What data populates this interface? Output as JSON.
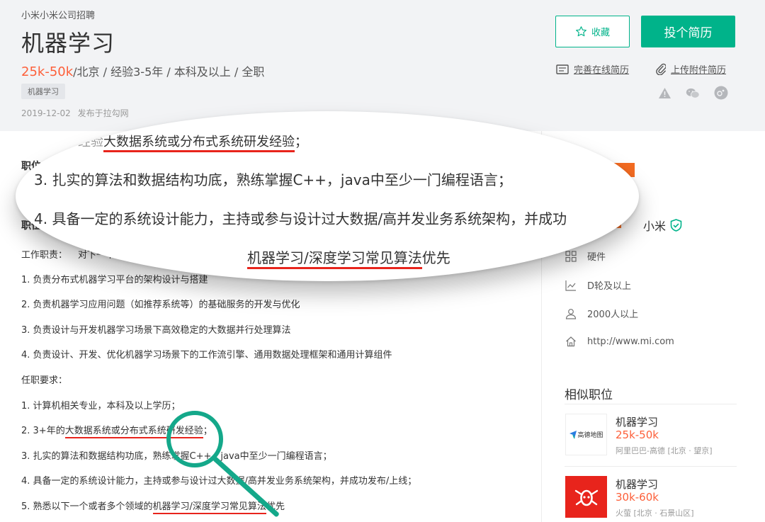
{
  "header": {
    "company_line": "小米小米公司招聘",
    "title": "机器学习",
    "salary": "25k-50k",
    "requirements": "/北京 / 经验3-5年 / 本科及以上 / 全职",
    "tag": "机器学习",
    "date": "2019-12-02",
    "source": "发布于拉勾网",
    "favorite_label": "收藏",
    "apply_label": "投个简历",
    "resume_online": "完善在线简历",
    "resume_upload": "上传附件简历",
    "icons": [
      "warning-icon",
      "wechat-icon",
      "share-icon"
    ]
  },
  "job": {
    "section1": "职位",
    "section2": "职位",
    "duty_head": "工作职责：",
    "duty_prefix": "对下一个或者多个领域的",
    "duties": [
      "1. 负责分布式机器学习平台的架构设计与搭建",
      "2. 负责机器学习应用问题（如推荐系统等）的基础服务的开发与优化",
      "3. 负责设计与开发机器学习场景下高效稳定的大数据并行处理算法",
      "4. 负责设计、开发、优化机器学习场景下的工作流引擎、通用数据处理框架和通用计算组件"
    ],
    "req_head": "任职要求：",
    "req1": "1. 计算机相关专业，本科及以上学历；",
    "req2_prefix": "2. 3+年的",
    "req2_ul": "大数据系统或分布式系统研发经验",
    "req2_suffix": "；",
    "req3": "3. 扎实的算法和数据结构功底，熟练掌握C++，java中至少一门编程语言；",
    "req4": "4. 具备一定的系统设计能力，主持或参与设计过大数据/高并发业务系统架构，并成功发布/上线；",
    "req5_prefix": "5. 熟悉以下一个或者多个领域的",
    "req5_ul": "机器学习/深度学习常见算法",
    "req5_suffix": "优先"
  },
  "lens": {
    "top_prefix": "经验",
    "top_ul": "大数据系统或分布式系统研发经验",
    "top_suffix": "；",
    "line3": "3. 扎实的算法和数据结构功底，熟练掌握C++，java中至少一门编程语言；",
    "line4": "4. 具备一定的系统设计能力，主持或参与设计过大数据/高并发业务系统架构，并成功",
    "line5_ul": "机器学习/深度学习常见算法",
    "line5_suffix": "优先"
  },
  "company": {
    "name": "小米",
    "logo_text": "mi",
    "industry": "硬件",
    "stage": "D轮及以上",
    "size": "2000人以上",
    "site": "http://www.mi.com"
  },
  "similar": {
    "title": "相似职位",
    "items": [
      {
        "name": "机器学习",
        "salary": "25k-50k",
        "company": "阿里巴巴-高德 [北京 · 望京]",
        "logo": "高德地图"
      },
      {
        "name": "机器学习",
        "salary": "30k-60k",
        "company": "火萤 [北京 · 石景山区]",
        "logo": ""
      }
    ]
  },
  "colors": {
    "brand_green": "#00b38a",
    "salary_orange": "#fd5f39",
    "highlight_red": "#e8241c",
    "mi_orange": "#f36b21",
    "magnifier_green": "#14a88a"
  }
}
